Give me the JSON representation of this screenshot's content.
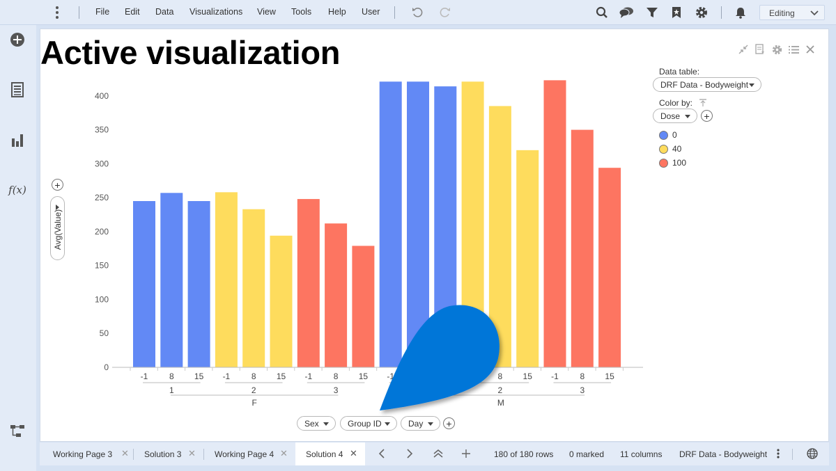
{
  "menu": {
    "items": [
      "File",
      "Edit",
      "Data",
      "Visualizations",
      "View",
      "Tools",
      "Help",
      "User"
    ],
    "mode_label": "Editing"
  },
  "icons": {
    "top": [
      "undo-icon",
      "redo-icon",
      "search-icon",
      "chat-icon",
      "filter-icon",
      "bookmark-icon",
      "gear-icon",
      "bell-icon"
    ],
    "sidebar": [
      "add-circle-icon",
      "data-table-icon",
      "bar-chart-icon",
      "fx-icon",
      "flow-icon"
    ],
    "fx_label": "f(x)"
  },
  "visualization": {
    "title": "Active visualization",
    "data_table_label": "Data table:",
    "data_table_value": "DRF Data - Bodyweight",
    "color_by_label": "Color by:",
    "color_by_value": "Dose",
    "legend": [
      {
        "label": "0",
        "color": "#6289f5"
      },
      {
        "label": "40",
        "color": "#fedc5d"
      },
      {
        "label": "100",
        "color": "#fd7561"
      }
    ],
    "y_axis_selector": "Avg(Value)",
    "x_axis_selectors": [
      "Sex",
      "Group ID",
      "Day"
    ]
  },
  "chart_data": {
    "type": "bar",
    "ylabel": "Avg(Value)",
    "ylim": [
      0,
      425
    ],
    "yticks": [
      0,
      50,
      100,
      150,
      200,
      250,
      300,
      350,
      400
    ],
    "x_levels": [
      "Sex",
      "Group ID",
      "Day"
    ],
    "groups": [
      {
        "sex": "F",
        "group": "1",
        "days": [
          "-1",
          "8",
          "15"
        ],
        "dose": "0",
        "values": [
          245,
          257,
          245
        ]
      },
      {
        "sex": "F",
        "group": "2",
        "days": [
          "-1",
          "8",
          "15"
        ],
        "dose": "40",
        "values": [
          258,
          233,
          194
        ]
      },
      {
        "sex": "F",
        "group": "3",
        "days": [
          "-1",
          "8",
          "15"
        ],
        "dose": "100",
        "values": [
          248,
          212,
          179
        ]
      },
      {
        "sex": "M",
        "group": "1",
        "days": [
          "-1",
          "8",
          "15"
        ],
        "dose": "0",
        "values": [
          421,
          421,
          414
        ]
      },
      {
        "sex": "M",
        "group": "2",
        "days": [
          "-1",
          "8",
          "15"
        ],
        "dose": "40",
        "values": [
          421,
          385,
          320
        ]
      },
      {
        "sex": "M",
        "group": "3",
        "days": [
          "-1",
          "8",
          "15"
        ],
        "dose": "100",
        "values": [
          423,
          350,
          294
        ]
      }
    ]
  },
  "tabs": [
    {
      "label": "Working Page 3",
      "active": false
    },
    {
      "label": "Solution 3",
      "active": false
    },
    {
      "label": "Working Page 4",
      "active": false
    },
    {
      "label": "Solution 4",
      "active": true
    }
  ],
  "status": {
    "rows": "180 of 180 rows",
    "marked": "0 marked",
    "columns": "11 columns",
    "table": "DRF Data - Bodyweight"
  }
}
